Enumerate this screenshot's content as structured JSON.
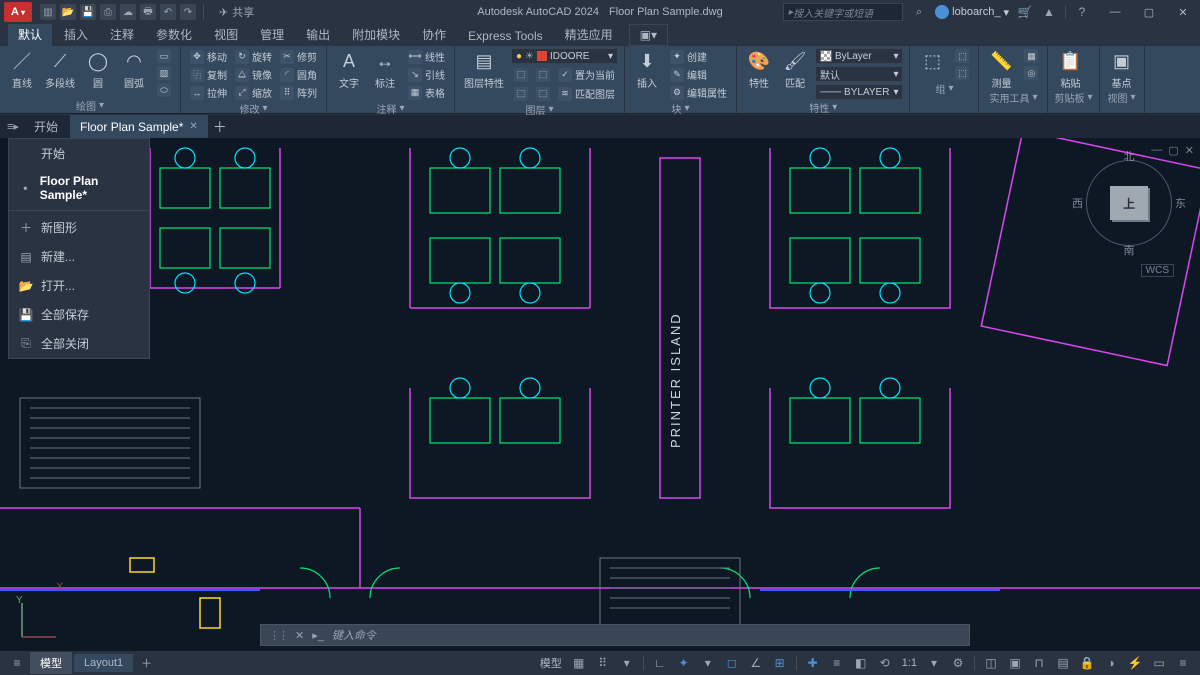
{
  "title": {
    "app": "Autodesk AutoCAD 2024",
    "file": "Floor Plan Sample.dwg"
  },
  "share_label": "共享",
  "search_placeholder": "搜入关键字或短语",
  "username": "loboarch_",
  "ribbon": {
    "tabs": [
      "默认",
      "插入",
      "注释",
      "参数化",
      "视图",
      "管理",
      "输出",
      "附加模块",
      "协作",
      "Express Tools",
      "精选应用"
    ],
    "active_tab": 0,
    "panels": {
      "draw": {
        "name": "绘图",
        "items": [
          "直线",
          "多段线",
          "圆",
          "圆弧"
        ]
      },
      "modify": {
        "name": "修改",
        "items": [
          "移动",
          "旋转",
          "修剪",
          "复制",
          "镜像",
          "圆角",
          "拉伸",
          "缩放",
          "阵列"
        ]
      },
      "annot": {
        "name": "注释",
        "items": [
          "文字",
          "标注",
          "线性",
          "引线",
          "表格"
        ]
      },
      "layer": {
        "name": "图层",
        "items": [
          "图层特性"
        ],
        "current_layer": "IDOORE",
        "btns": [
          "置为当前",
          "匹配图层"
        ]
      },
      "block": {
        "name": "块",
        "items": [
          "插入",
          "创建",
          "编辑",
          "编辑属性"
        ]
      },
      "props": {
        "name": "特性",
        "items": [
          "特性",
          "匹配"
        ],
        "color": "ByLayer",
        "lw": "默认",
        "lt": "BYLAYER"
      },
      "group": {
        "name": "组"
      },
      "util": {
        "name": "实用工具",
        "item": "测量"
      },
      "clip": {
        "name": "剪贴板",
        "item": "粘贴"
      },
      "view": {
        "name": "视图",
        "item": "基点"
      }
    }
  },
  "filetabs": {
    "start": "开始",
    "active": "Floor Plan Sample*"
  },
  "doc_menu": {
    "items": [
      "开始",
      "Floor Plan Sample*"
    ],
    "actions": [
      {
        "icon": "＋",
        "label": "新图形"
      },
      {
        "icon": "▤",
        "label": "新建..."
      },
      {
        "icon": "📂",
        "label": "打开..."
      },
      {
        "icon": "💾",
        "label": "全部保存"
      },
      {
        "icon": "⎘",
        "label": "全部关闭"
      }
    ]
  },
  "viewcube": {
    "face": "上",
    "n": "北",
    "s": "南",
    "e": "东",
    "w": "西",
    "wcs": "WCS"
  },
  "drawing": {
    "room_label": "PRINTER ISLAND"
  },
  "cmd": {
    "prompt": "键入命令"
  },
  "status": {
    "layout_tabs": [
      "模型",
      "Layout1"
    ],
    "active_layout": 0,
    "model_btn": "模型",
    "scale": "1:1"
  }
}
